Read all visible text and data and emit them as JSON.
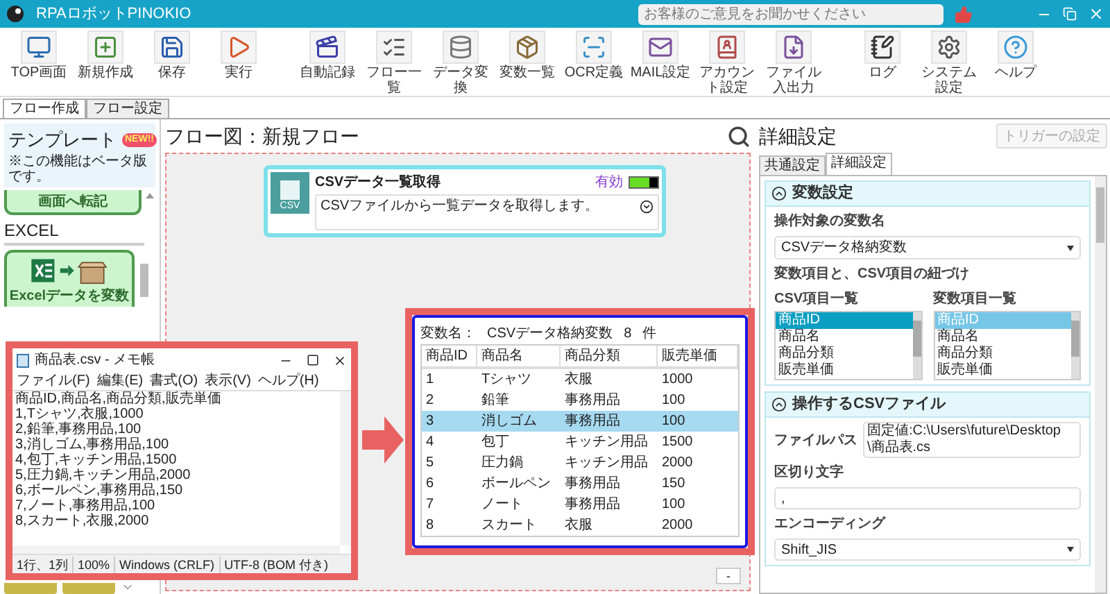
{
  "app": {
    "title": "RPAロボットPINOKIO",
    "feedback": {
      "placeholder": "お客様のご意見をお聞かせください"
    }
  },
  "toolbar": [
    [
      {
        "kind": "top",
        "label": "TOP画面"
      },
      {
        "kind": "new",
        "label": "新規作成"
      },
      {
        "kind": "save",
        "label": "保存"
      },
      {
        "kind": "run",
        "label": "実行"
      }
    ],
    [
      {
        "kind": "record",
        "label": "自動記録"
      },
      {
        "kind": "list",
        "label": "フロー一覧"
      },
      {
        "kind": "data",
        "label": "データ変換"
      },
      {
        "kind": "vars",
        "label": "変数一覧"
      },
      {
        "kind": "ocr",
        "label": "OCR定義"
      },
      {
        "kind": "mail",
        "label": "MAIL設定"
      },
      {
        "kind": "account",
        "label": "アカウント設定"
      },
      {
        "kind": "file",
        "label": "ファイル入出力"
      }
    ],
    [
      {
        "kind": "log",
        "label": "ログ"
      },
      {
        "kind": "settings",
        "label": "システム設定"
      },
      {
        "kind": "help",
        "label": "ヘルプ"
      }
    ]
  ],
  "main_tabs": [
    {
      "label": "フロー作成",
      "selected": true
    },
    {
      "label": "フロー設定",
      "selected": false
    }
  ],
  "templates": {
    "title": "テンプレート",
    "badge": "NEW!!",
    "note": "※この機能はベータ版です。",
    "partial_card": "画面へ転記",
    "section": "EXCEL",
    "card": "Excelデータを変数"
  },
  "flow": {
    "title": "フロー図：新規フロー",
    "node": {
      "title": "CSVデータ一覧取得",
      "icon_label": "CSV",
      "status": "有効",
      "on": true,
      "description": "CSVファイルから一覧データを取得します。"
    },
    "zoom_button": "-"
  },
  "notepad": {
    "title": "商品表.csv - メモ帳",
    "menu": [
      "ファイル(F)",
      "編集(E)",
      "書式(O)",
      "表示(V)",
      "ヘルプ(H)"
    ],
    "lines": [
      "商品ID,商品名,商品分類,販売単価",
      "1,Tシャツ,衣服,1000",
      "2,鉛筆,事務用品,100",
      "3,消しゴム,事務用品,100",
      "4,包丁,キッチン用品,1500",
      "5,圧力鍋,キッチン用品,2000",
      "6,ボールペン,事務用品,150",
      "7,ノート,事務用品,100",
      "8,スカート,衣服,2000"
    ],
    "status": [
      "1行、1列",
      "100%",
      "Windows (CRLF)",
      "UTF-8 (BOM 付き)"
    ]
  },
  "result": {
    "caption_label": "変数名：",
    "variable": "CSVデータ格納変数",
    "count": "8",
    "count_unit": "件",
    "columns": [
      "商品ID",
      "商品名",
      "商品分類",
      "販売単価"
    ],
    "rows": [
      {
        "cells": [
          "1",
          "Tシャツ",
          "衣服",
          "1000"
        ],
        "selected": false
      },
      {
        "cells": [
          "2",
          "鉛筆",
          "事務用品",
          "100"
        ],
        "selected": false
      },
      {
        "cells": [
          "3",
          "消しゴム",
          "事務用品",
          "100"
        ],
        "selected": true
      },
      {
        "cells": [
          "4",
          "包丁",
          "キッチン用品",
          "1500"
        ],
        "selected": false
      },
      {
        "cells": [
          "5",
          "圧力鍋",
          "キッチン用品",
          "2000"
        ],
        "selected": false
      },
      {
        "cells": [
          "6",
          "ボールペン",
          "事務用品",
          "150"
        ],
        "selected": false
      },
      {
        "cells": [
          "7",
          "ノート",
          "事務用品",
          "100"
        ],
        "selected": false
      },
      {
        "cells": [
          "8",
          "スカート",
          "衣服",
          "2000"
        ],
        "selected": false
      }
    ]
  },
  "details": {
    "title": "詳細設定",
    "trigger_button": {
      "label": "トリガーの設定",
      "disabled": true
    },
    "tabs": [
      {
        "label": "共通設定",
        "selected": false
      },
      {
        "label": "詳細設定",
        "selected": true
      }
    ],
    "variable_section": {
      "title": "変数設定",
      "expanded": true,
      "target_label": "操作対象の変数名",
      "target_value": "CSVデータ格納変数",
      "mapping_label": "変数項目と、CSV項目の紐づけ",
      "lists": [
        {
          "title": "CSV項目一覧",
          "items": [
            {
              "label": "商品ID",
              "selected": true
            },
            {
              "label": "商品名",
              "selected": false
            },
            {
              "label": "商品分類",
              "selected": false
            },
            {
              "label": "販売単価",
              "selected": false
            }
          ]
        },
        {
          "title": "変数項目一覧",
          "items": [
            {
              "label": "商品ID",
              "selected": true
            },
            {
              "label": "商品名",
              "selected": false
            },
            {
              "label": "商品分類",
              "selected": false
            },
            {
              "label": "販売単価",
              "selected": false
            }
          ]
        }
      ]
    },
    "file_section": {
      "title": "操作するCSVファイル",
      "expanded": true,
      "path_label": "ファイルパス",
      "path_value": "固定値:C:\\Users\\future\\Desktop\\商品表.cs",
      "delimiter_label": "区切り文字",
      "delimiter_value": ",",
      "encoding_label": "エンコーディング",
      "encoding_value": "Shift_JIS"
    }
  }
}
